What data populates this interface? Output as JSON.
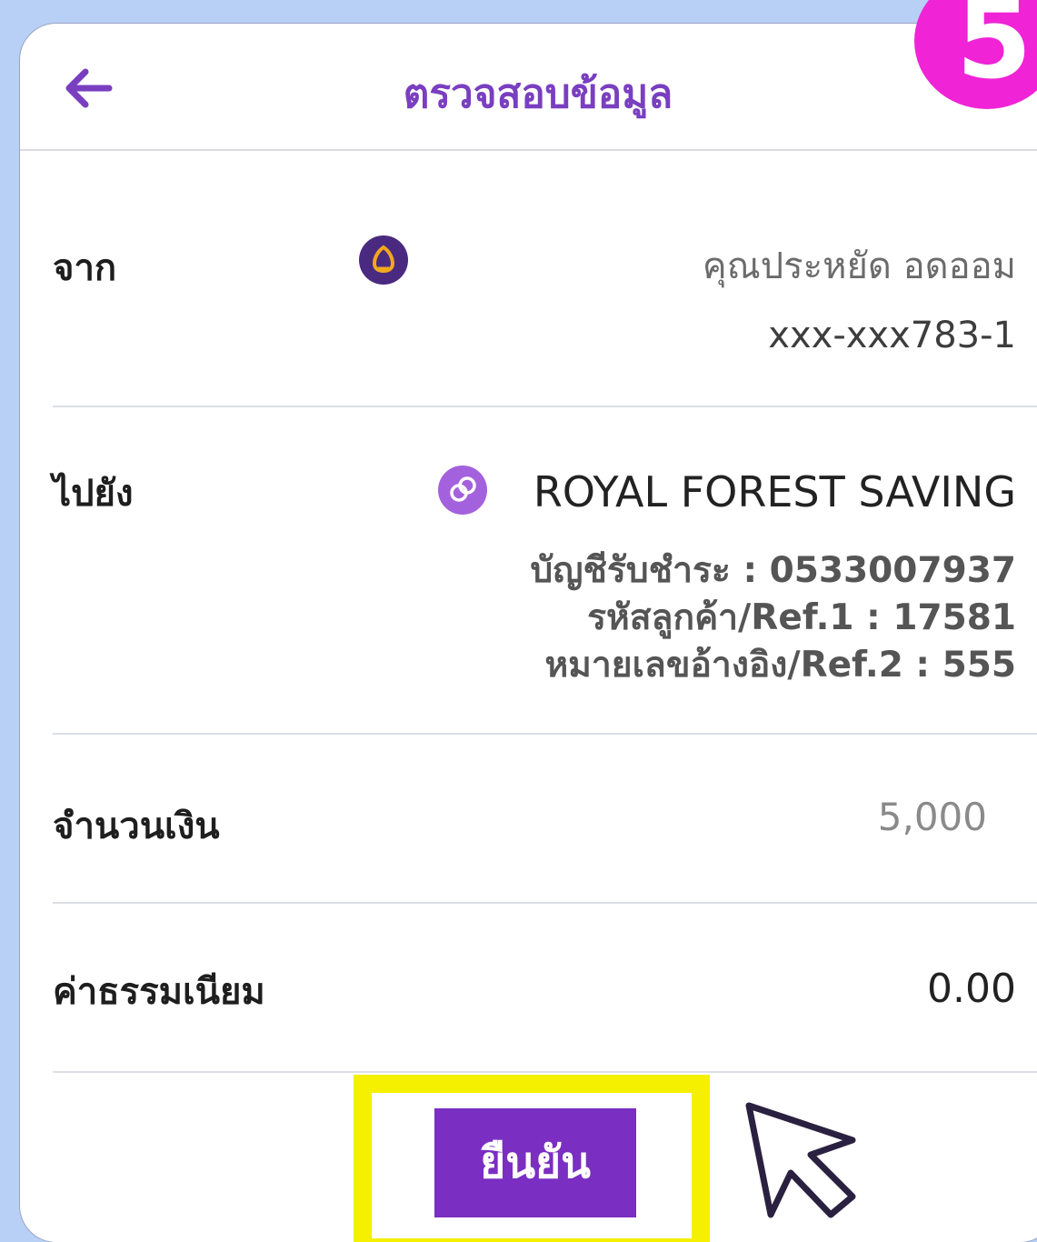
{
  "header": {
    "title": "ตรวจสอบข้อมูล",
    "step_badge": "5"
  },
  "from": {
    "label": "จาก",
    "account_name": "คุณประหยัด อดออม",
    "account_number": "xxx-xxx783-1",
    "bank_icon": "bank-logo-icon"
  },
  "to": {
    "label": "ไปยัง",
    "payee_name": "ROYAL FOREST SAVING",
    "payee_icon": "biller-icon",
    "account_line": "บัญชีรับชำระ : 0533007937",
    "ref1_line": "รหัสลูกค้า/Ref.1 : 17581",
    "ref2_line": "หมายเลขอ้างอิง/Ref.2 : 555"
  },
  "amount": {
    "label": "จำนวนเงิน",
    "value": "5,000"
  },
  "fee": {
    "label": "ค่าธรรมเนียม",
    "value": "0.00"
  },
  "confirm_button": {
    "label": "ยืนยัน"
  },
  "colors": {
    "accent": "#7a2ec2",
    "highlight": "#f4f000",
    "step_badge": "#f024d6",
    "background": "#b8d0f6"
  }
}
